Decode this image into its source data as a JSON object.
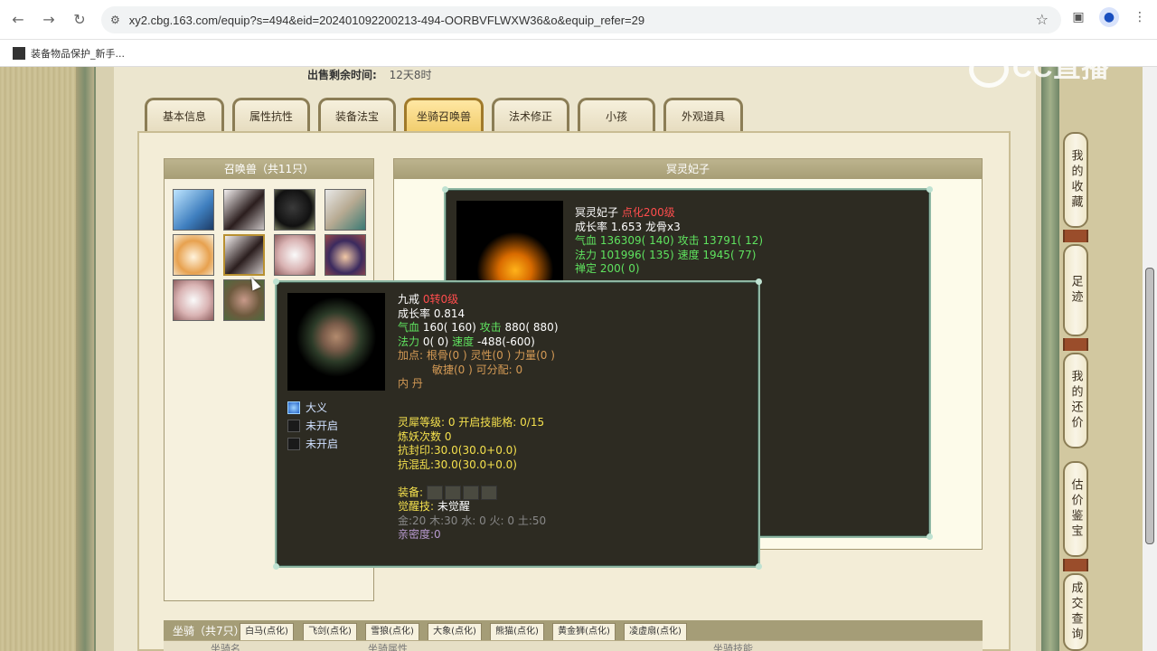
{
  "browser": {
    "url": "xy2.cbg.163.com/equip?s=494&eid=202401092200213-494-OORBVFLWXW36&o&equip_refer=29",
    "bookmark": "装备物品保护_新手..."
  },
  "watermark": "CC直播",
  "sale": {
    "label": "出售剩余时间:",
    "value": "12天8时"
  },
  "tabs": [
    "基本信息",
    "属性抗性",
    "装备法宝",
    "坐骑召唤兽",
    "法术修正",
    "小孩",
    "外观道具"
  ],
  "summon_list": {
    "title": "召唤兽（共11只）"
  },
  "detail": {
    "title": "冥灵妃子",
    "pet": {
      "name": "冥灵妃子",
      "level": "点化200级",
      "growth": "成长率 1.653 龙骨x3",
      "hp_label": "气血",
      "hp": "136309( 140)",
      "atk_label": "攻击",
      "atk": "13791( 12)",
      "mp_label": "法力",
      "mp": "101996( 135)",
      "spd_label": "速度",
      "spd": "1945( 77)",
      "zen": "禅定 200( 0)"
    }
  },
  "popup": {
    "name": "九戒",
    "level": "0转0级",
    "growth": "成长率 0.814",
    "hp_label": "气血",
    "hp": "160( 160)",
    "atk_label": "攻击",
    "atk": "880( 880)",
    "mp_label": "法力",
    "mp": "0( 0)",
    "spd_label": "速度",
    "spd": "-488(-600)",
    "points_label": "加点:",
    "points1": "根骨(0 ) 灵性(0 ) 力量(0 )",
    "points2": "敏捷(0 ) 可分配: 0",
    "neidan": "内    丹",
    "skills": [
      "大义",
      "未开启",
      "未开启"
    ],
    "lingxi": "灵犀等级: 0 开启技能格: 0/15",
    "lianyao": "炼妖次数 0",
    "kangfengyin_label": "抗封印:",
    "kangfengyin": "30.0(30.0+0.0)",
    "kanghunluan_label": "抗混乱:",
    "kanghunluan": "30.0(30.0+0.0)",
    "equip_label": "装备:",
    "awaken_label": "觉醒技:",
    "awaken_value": "未觉醒",
    "elements": "金:20 木:30 水: 0 火: 0 土:50",
    "intimacy": "亲密度:0"
  },
  "mount": {
    "title": "坐骑（共7只）",
    "tabs": [
      "白马(点化)",
      "飞剑(点化)",
      "雪狼(点化)",
      "大象(点化)",
      "熊猫(点化)",
      "黄金狮(点化)",
      "凌虚扇(点化)"
    ],
    "sub_headers": [
      "坐骑名",
      "坐骑属性",
      "坐骑技能"
    ]
  },
  "right_buttons": [
    "我的收藏",
    "足迹",
    "我的还价",
    "估价鉴宝",
    "成交查询"
  ]
}
